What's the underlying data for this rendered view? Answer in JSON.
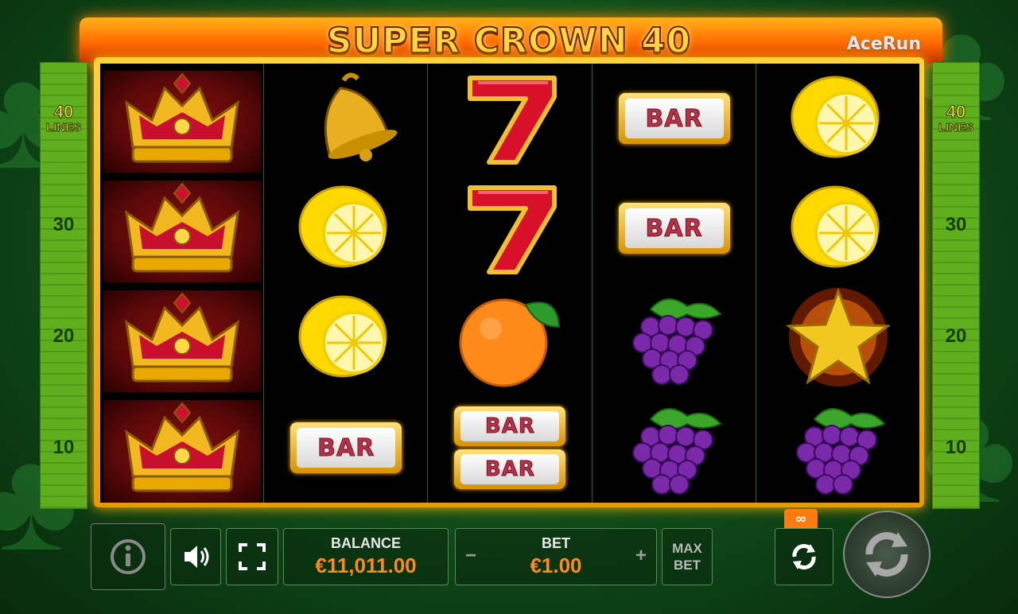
{
  "game": {
    "title": "SUPER CROWN 40",
    "brand": "AceRun"
  },
  "lines": {
    "top_label": "40",
    "top_sub": "LINES",
    "marks": [
      "30",
      "20",
      "10"
    ]
  },
  "reels": [
    [
      "crown-icon",
      "crown-icon",
      "crown-icon",
      "crown-icon"
    ],
    [
      "bell-icon",
      "lemon-icon",
      "lemon-icon",
      "bar-icon"
    ],
    [
      "seven-icon",
      "seven-icon",
      "orange-icon",
      "double-bar-icon"
    ],
    [
      "bar-icon",
      "bar-icon",
      "grapes-icon",
      "grapes-icon"
    ],
    [
      "lemon-icon",
      "lemon-icon",
      "star-icon",
      "grapes-icon"
    ]
  ],
  "bar_text": "BAR",
  "controls": {
    "balance_label": "BALANCE",
    "balance_value": "€11,011.00",
    "bet_label": "BET",
    "bet_value": "€1.00",
    "bet_minus": "−",
    "bet_plus": "+",
    "max_bet_line1": "MAX",
    "max_bet_line2": "BET",
    "autoplay_count": "∞"
  },
  "colors": {
    "accent": "#ff8a1a",
    "frame": "#ffd23a",
    "lines_panel": "#5fae1d"
  }
}
